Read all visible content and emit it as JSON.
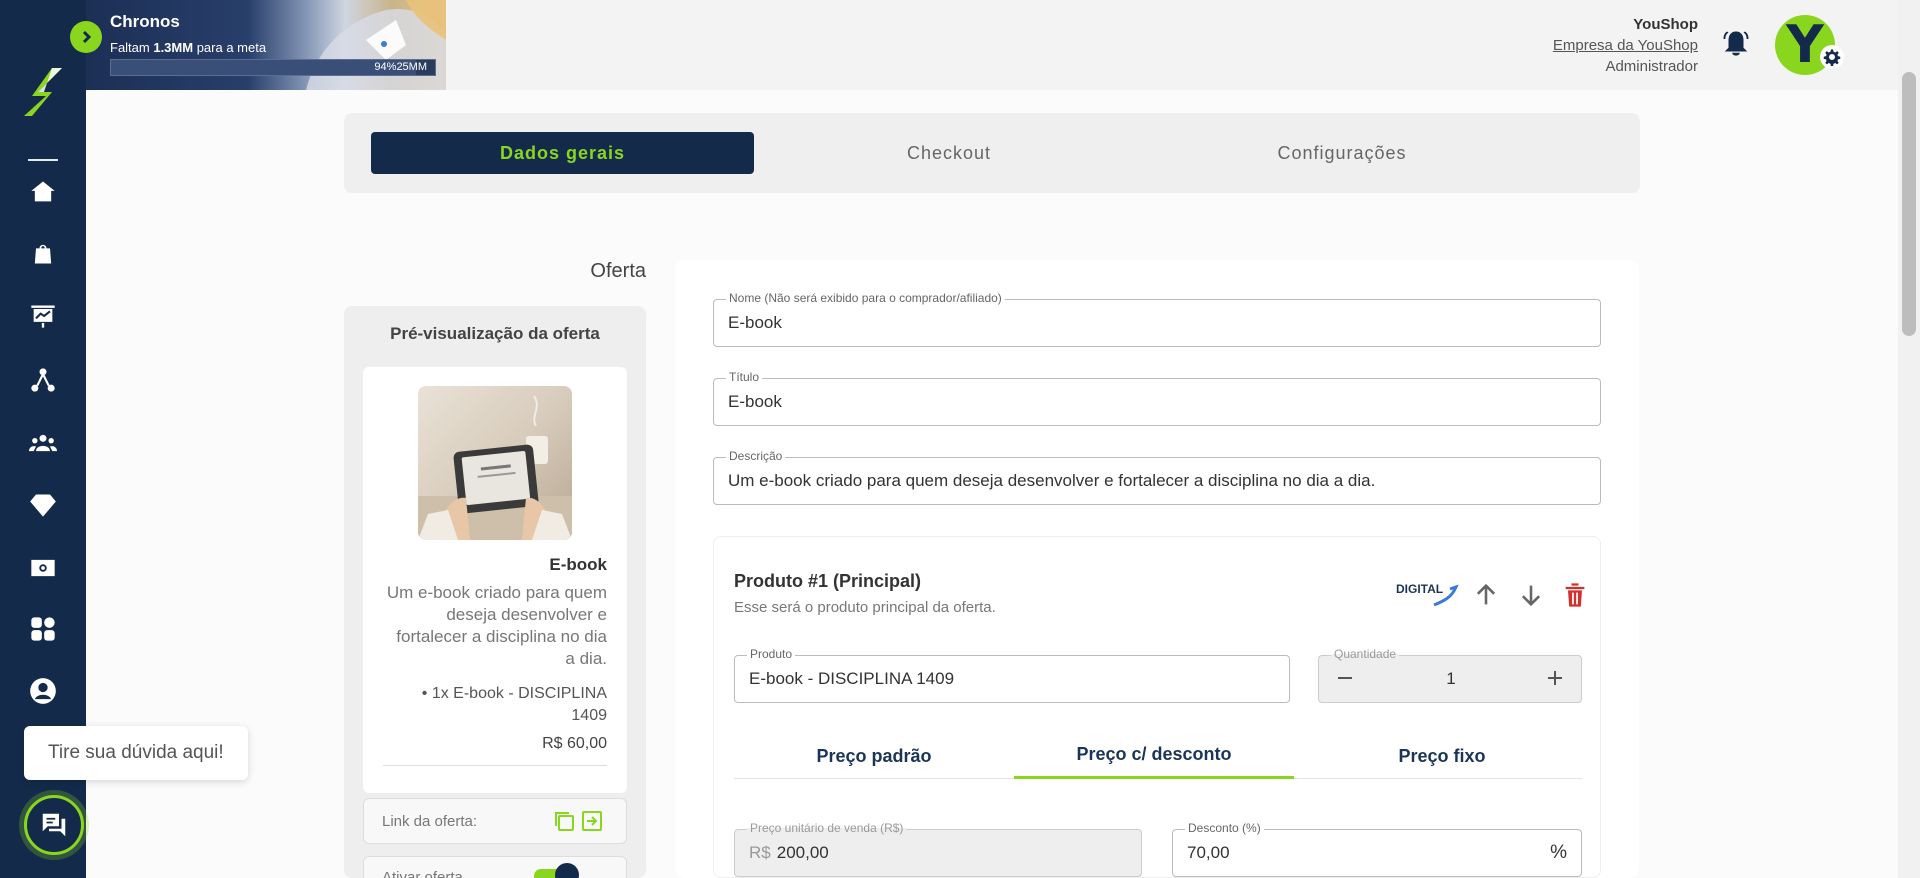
{
  "banner": {
    "title": "Chronos",
    "subtitle_prefix": "Faltam ",
    "subtitle_amount": "1.3MM",
    "subtitle_suffix": " para a meta",
    "progress_percent": 94,
    "progress_text": "94%25MM"
  },
  "header": {
    "user_name": "YouShop",
    "company": "Empresa da YouShop",
    "role": "Administrador",
    "avatar_letter": "Y"
  },
  "sidebar": {
    "items": [
      {
        "icon": "home-icon"
      },
      {
        "icon": "shopping-bag-icon"
      },
      {
        "icon": "presentation-chart-icon"
      },
      {
        "icon": "network-icon"
      },
      {
        "icon": "users-group-icon"
      },
      {
        "icon": "diamond-icon"
      },
      {
        "icon": "money-icon"
      },
      {
        "icon": "apps-grid-icon"
      },
      {
        "icon": "user-circle-icon"
      }
    ]
  },
  "tabs": [
    {
      "label": "Dados gerais",
      "active": true
    },
    {
      "label": "Checkout",
      "active": false
    },
    {
      "label": "Configurações",
      "active": false
    }
  ],
  "section_title": "Oferta",
  "preview": {
    "title": "Pré-visualização da oferta",
    "product_name": "E-book",
    "description": "Um e-book criado para quem deseja desenvolver e fortalecer a disciplina no dia a dia.",
    "item": "• 1x E-book - DISCIPLINA 1409",
    "price": "R$ 60,00",
    "link_label": "Link da oferta:",
    "active_label": "Ativar oferta"
  },
  "form": {
    "name": {
      "label": "Nome (Não será exibido para o comprador/afiliado)",
      "value": "E-book"
    },
    "title": {
      "label": "Título",
      "value": "E-book"
    },
    "description": {
      "label": "Descrição",
      "value": "Um e-book criado para quem deseja desenvolver e fortalecer a disciplina no dia a dia."
    }
  },
  "product": {
    "title": "Produto #1 (Principal)",
    "subtitle": "Esse será o produto principal da oferta.",
    "badge": "DIGITAL",
    "product_field": {
      "label": "Produto",
      "value": "E-book - DISCIPLINA 1409"
    },
    "quantity_field": {
      "label": "Quantidade",
      "value": "1"
    },
    "price_tabs": [
      {
        "label": "Preço padrão",
        "active": false
      },
      {
        "label": "Preço c/ desconto",
        "active": true
      },
      {
        "label": "Preço fixo",
        "active": false
      }
    ],
    "unit_price": {
      "label": "Preço unitário de venda (R$)",
      "prefix": "R$",
      "value": "200,00"
    },
    "discount": {
      "label": "Desconto (%)",
      "value": "70,00",
      "suffix": "%"
    }
  },
  "help": {
    "bubble_text": "Tire sua dúvida aqui!"
  },
  "colors": {
    "primary": "#132a4a",
    "accent": "#8ad61f",
    "danger": "#d32f2f"
  }
}
